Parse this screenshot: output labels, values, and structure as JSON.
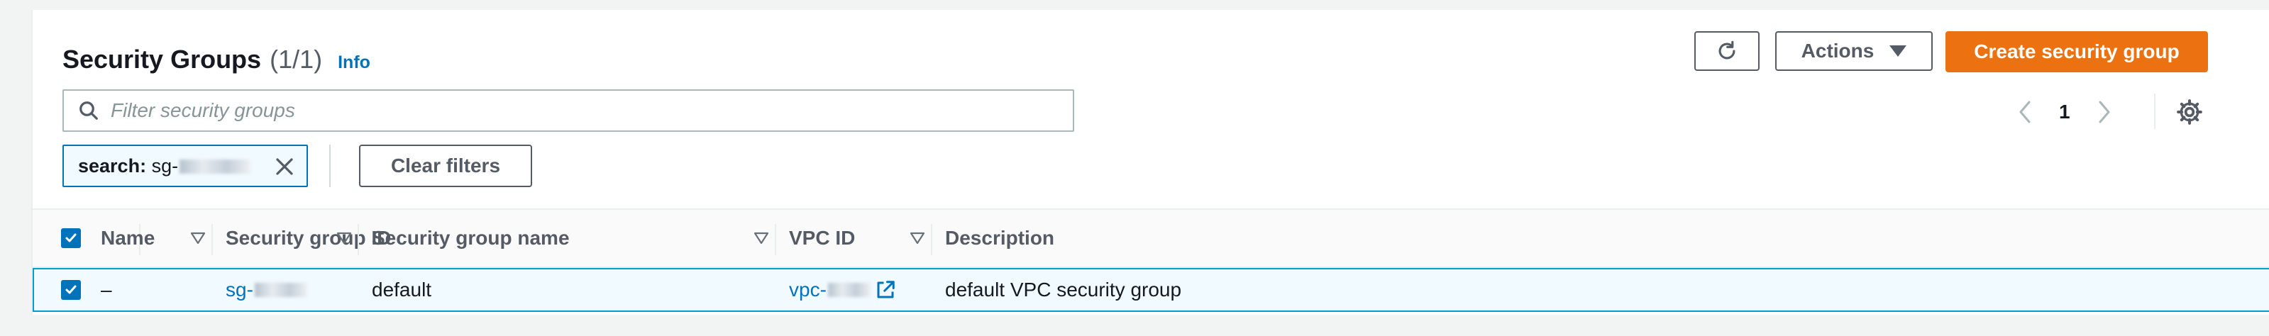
{
  "header": {
    "title": "Security Groups",
    "count": "(1/1)",
    "info": "Info"
  },
  "toolbar": {
    "refresh_icon": "refresh-icon",
    "actions_label": "Actions",
    "create_label": "Create security group"
  },
  "search": {
    "placeholder": "Filter security groups",
    "value": ""
  },
  "pagination": {
    "current_page": "1"
  },
  "filter_token": {
    "key": "search:",
    "value_prefix": "sg-"
  },
  "clear_filters_label": "Clear filters",
  "table": {
    "columns": [
      "Name",
      "Security group ID",
      "Security group name",
      "VPC ID",
      "Description"
    ],
    "rows": [
      {
        "selected": true,
        "name": "–",
        "security_group_id": "sg-",
        "security_group_name": "default",
        "vpc_id": "vpc-",
        "description": "default VPC security group"
      }
    ]
  },
  "colors": {
    "primary": "#ec7211",
    "link": "#0073bb",
    "selected_row_bg": "#f1faff",
    "selected_row_border": "#00a1c9"
  }
}
